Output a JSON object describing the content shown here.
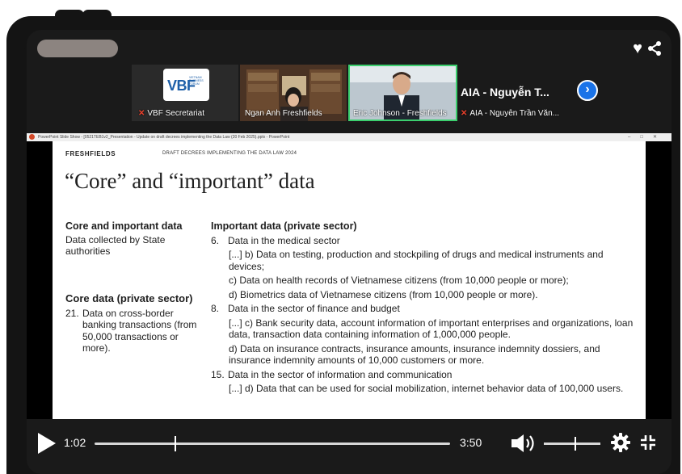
{
  "participants": [
    {
      "name": "VBF Secretariat",
      "muted": true,
      "logo_text": "VBF",
      "logo_subtext": [
        "VIETNAM",
        "BUSINESS",
        "FORUM"
      ]
    },
    {
      "name": "Ngan Anh Freshfields",
      "muted": false
    },
    {
      "name": "Eric Johnson - Freshfields",
      "muted": false,
      "active": true
    },
    {
      "name": "AIA - Nguyễn Trần Văn...",
      "muted": true,
      "display_title": "AIA - Nguyễn T..."
    }
  ],
  "powerpoint_bar": {
    "title": "PowerPoint Slide Show - [0521TEB1v2_Presentation - Update on draft decrees implementing the Data Law (20 Feb 2025).pptx - PowerPoint"
  },
  "slide": {
    "logo": "FRESHFIELDS",
    "header": "DRAFT DECREES IMPLEMENTING THE DATA LAW 2024",
    "title": "“Core” and “important” data",
    "left": {
      "heading1": "Core and important data",
      "text1": "Data collected by State authorities",
      "heading2": "Core data (private sector)",
      "item_num": "21.",
      "item_text": "Data on cross-border banking transactions (from 50,000 transactions or more)."
    },
    "right": {
      "heading": "Important data  (private sector)",
      "s6_num": "6.",
      "s6_title": "Data in the medical sector",
      "s6_b": "[...] b) Data on testing, production and stockpiling of drugs and medical instruments and devices;",
      "s6_c": "c) Data on health records of Vietnamese citizens (from 10,000 people or more);",
      "s6_d": "d) Biometrics data of Vietnamese citizens (from 10,000 people or more).",
      "s8_num": "8.",
      "s8_title": "Data in the sector of finance and budget",
      "s8_c": "[...] c) Bank security data, account information of important enterprises and organizations, loan data, transaction data containing information of 1,000,000 people.",
      "s8_d": "d) Data on insurance contracts, insurance amounts, insurance indemnity dossiers, and insurance indemnity amounts of 10,000 customers or more.",
      "s15_num": "15.",
      "s15_title": "Data in the sector of information and communication",
      "s15_d": "[...] d) Data that can be used for social mobilization, internet behavior data of 100,000 users."
    }
  },
  "player": {
    "current_time": "1:02",
    "duration": "3:50",
    "progress": 0.228,
    "volume": 0.55
  },
  "colors": {
    "accent_blue": "#1a73e8",
    "active_border": "#3ccf6e",
    "mute_red": "#e8412c",
    "ppt_red": "#d24726"
  }
}
